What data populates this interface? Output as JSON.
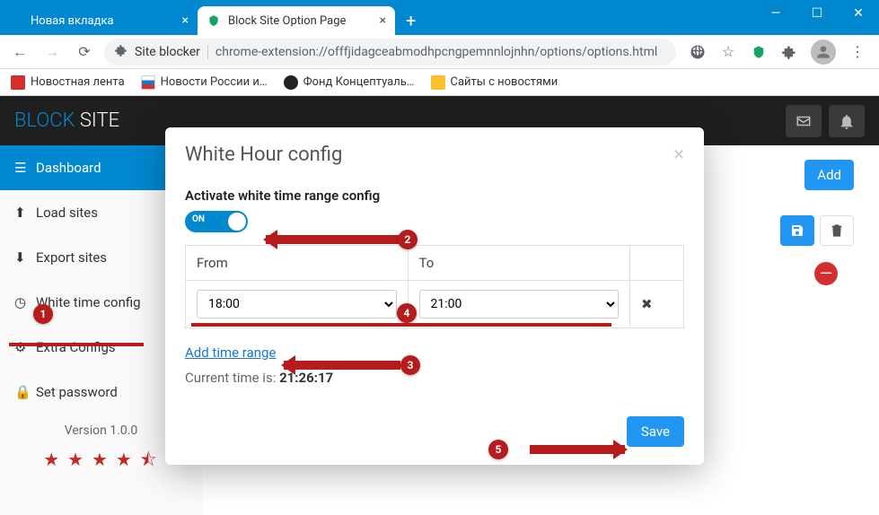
{
  "tabs": {
    "t0": {
      "label": "Новая вкладка"
    },
    "t1": {
      "label": "Block Site Option Page"
    }
  },
  "url": {
    "siteinfo": "Site blocker",
    "path": "chrome-extension://offfjidagceabmodhpcngpemnnlojnhn/options/options.html"
  },
  "bookmarks": {
    "b0": "Новостная лента",
    "b1": "Новости России и…",
    "b2": "Фонд Концептуаль…",
    "b3": "Сайты с новостями"
  },
  "app": {
    "title_a": "BLOCK",
    "title_b": "SITE"
  },
  "sidebar": {
    "dashboard": "Dashboard",
    "load": "Load sites",
    "export": "Export sites",
    "white": "White time config",
    "extra": "Extra Configs",
    "pwd": "Set password",
    "version": "Version 1.0.0"
  },
  "main": {
    "add": "Add"
  },
  "modal": {
    "title": "White Hour config",
    "activate": "Activate white time range config",
    "toggle": "ON",
    "from": "From",
    "to": "To",
    "from_val": "18:00",
    "to_val": "21:00",
    "add_range": "Add time range",
    "cur_label": "Current time is: ",
    "cur_val": "21:26:17",
    "save": "Save"
  },
  "anno": {
    "n1": "1",
    "n2": "2",
    "n3": "3",
    "n4": "4",
    "n5": "5"
  }
}
